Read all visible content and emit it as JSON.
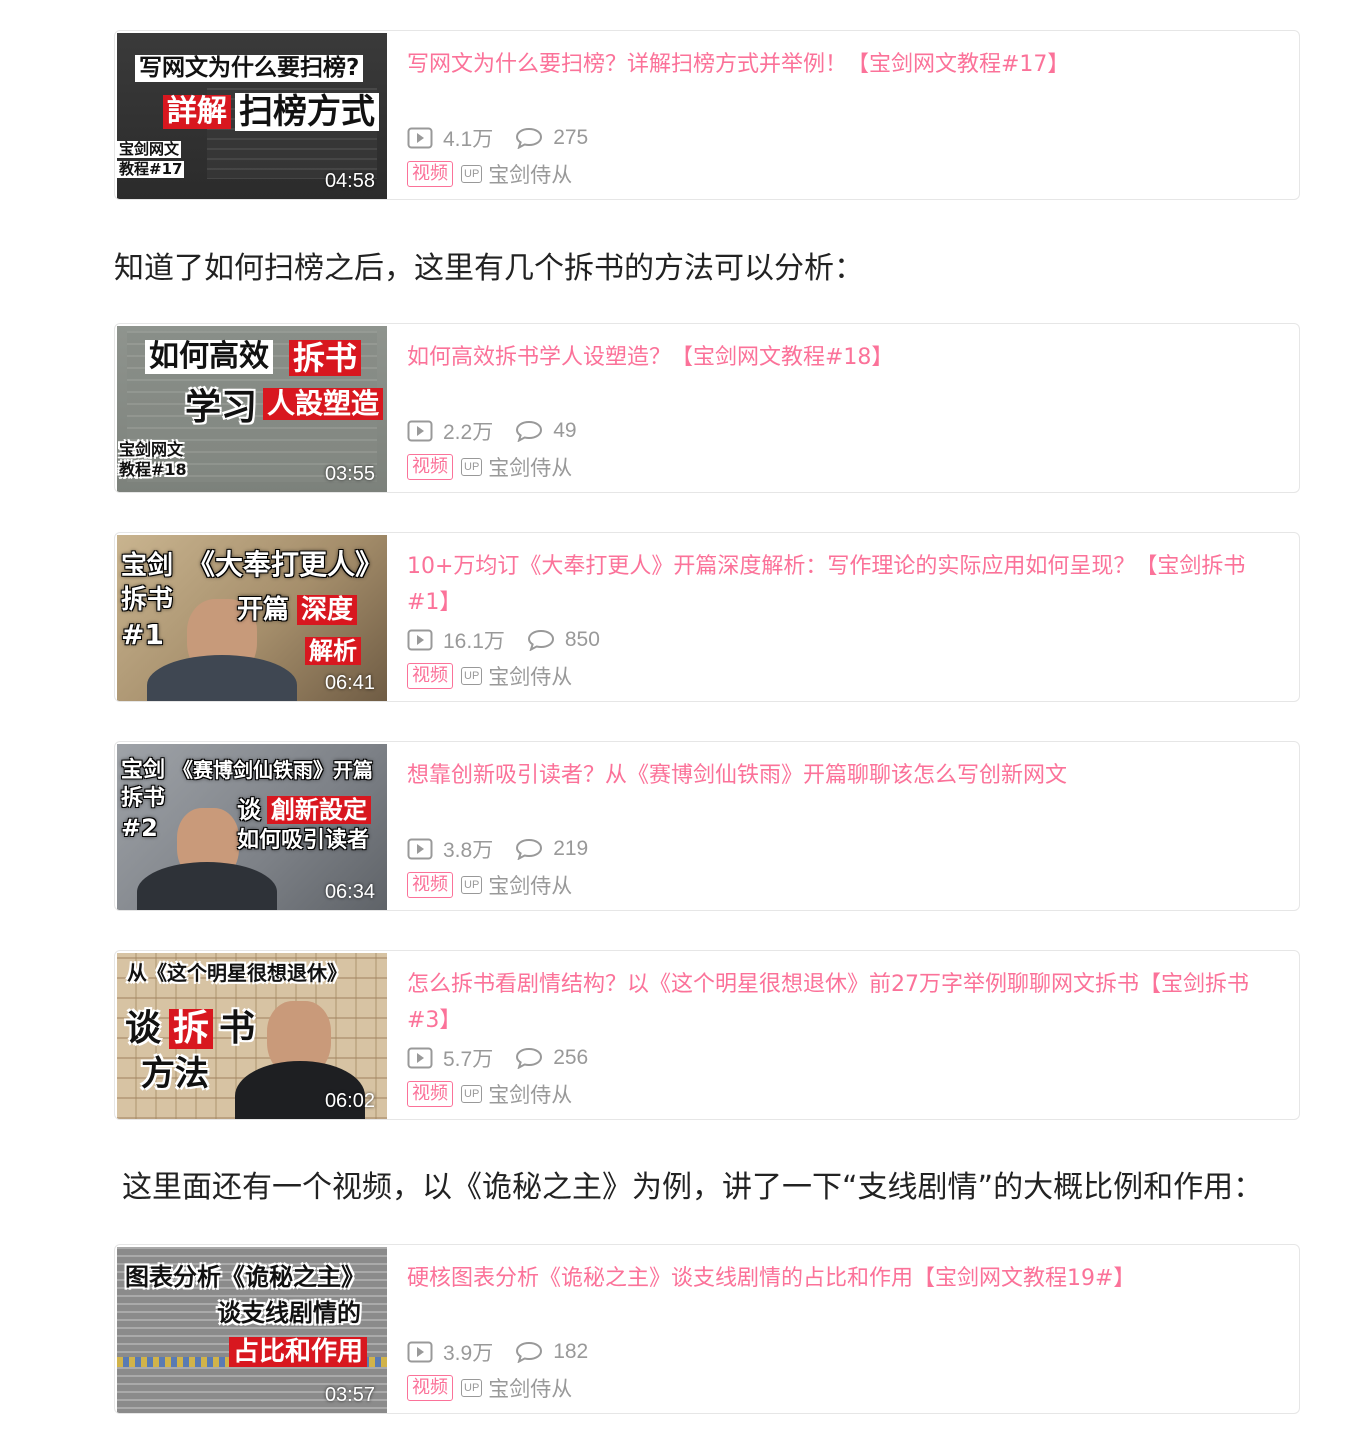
{
  "paragraphs": [
    "知道了如何扫榜之后，这里有几个拆书的方法可以分析：",
    "这里面还有一个视频，以《诡秘之主》为例，讲了一下“支线剧情”的大概比例和作用："
  ],
  "colors": {
    "title_pink": "#fb7299",
    "meta_gray": "#999999",
    "thumb_red": "#d8171f"
  },
  "icons": {
    "play": "play-count-icon",
    "comment": "comment-icon",
    "up": "up-badge-icon"
  },
  "cards": [
    {
      "title": "写网文为什么要扫榜？详解扫榜方式并举例！【宝剑网文教程#17】",
      "views": "4.1万",
      "comments": "275",
      "tag": "视频",
      "up_label": "UP",
      "author": "宝剑侍从",
      "duration": "04:58",
      "thumb_text": [
        "写网文为什么要扫榜?",
        "詳解",
        "扫榜方式",
        "宝剑网文",
        "教程#17"
      ]
    },
    {
      "title": "如何高效拆书学人设塑造？【宝剑网文教程#18】",
      "views": "2.2万",
      "comments": "49",
      "tag": "视频",
      "up_label": "UP",
      "author": "宝剑侍从",
      "duration": "03:55",
      "thumb_text": [
        "如何高效",
        "拆书",
        "学习",
        "人設塑造",
        "宝剑网文",
        "教程#18"
      ]
    },
    {
      "title": "10+万均订《大奉打更人》开篇深度解析：写作理论的实际应用如何呈现？【宝剑拆书#1】",
      "views": "16.1万",
      "comments": "850",
      "tag": "视频",
      "up_label": "UP",
      "author": "宝剑侍从",
      "duration": "06:41",
      "thumb_text": [
        "宝剑",
        "拆书",
        "#1",
        "《大奉打更人》",
        "开篇",
        "深度",
        "解析"
      ]
    },
    {
      "title": "想靠创新吸引读者？从《赛博剑仙铁雨》开篇聊聊该怎么写创新网文",
      "views": "3.8万",
      "comments": "219",
      "tag": "视频",
      "up_label": "UP",
      "author": "宝剑侍从",
      "duration": "06:34",
      "thumb_text": [
        "宝剑",
        "《赛博剑仙铁雨》开篇",
        "拆书",
        "#2",
        "谈",
        "創新設定",
        "如何吸引读者"
      ]
    },
    {
      "title": "怎么拆书看剧情结构？以《这个明星很想退休》前27万字举例聊聊网文拆书【宝剑拆书#3】",
      "views": "5.7万",
      "comments": "256",
      "tag": "视频",
      "up_label": "UP",
      "author": "宝剑侍从",
      "duration": "06:02",
      "thumb_text": [
        "从《这个明星很想退休》",
        "谈",
        "拆",
        "书",
        "方法"
      ]
    },
    {
      "title": "硬核图表分析《诡秘之主》谈支线剧情的占比和作用【宝剑网文教程19#】",
      "views": "3.9万",
      "comments": "182",
      "tag": "视频",
      "up_label": "UP",
      "author": "宝剑侍从",
      "duration": "03:57",
      "thumb_text": [
        "图表分析《诡秘之主》",
        "谈支线剧情的",
        "占比和作用"
      ]
    }
  ]
}
